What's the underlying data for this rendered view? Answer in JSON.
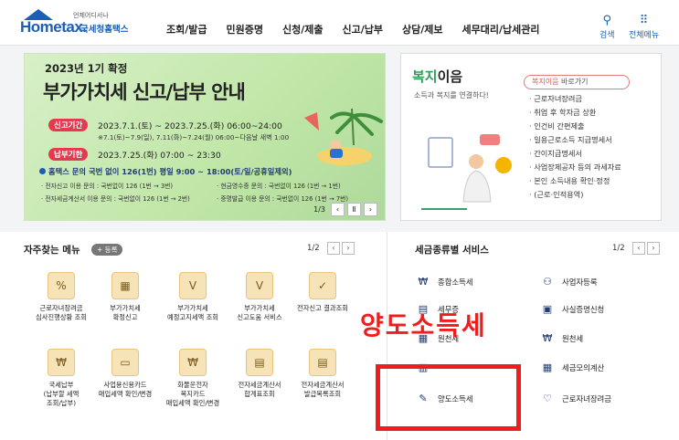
{
  "header": {
    "logo_text": "Hometax.",
    "logo_tagline": "언제어디서나",
    "logo_sub": "국세청홈택스",
    "nav": [
      "조회/발급",
      "민원증명",
      "신청/제출",
      "신고/납부",
      "상담/제보",
      "세무대리/납세관리"
    ],
    "tools": [
      {
        "icon": "search-icon",
        "glyph": "⚲",
        "label": "검색"
      },
      {
        "icon": "grid-menu-icon",
        "glyph": "⠿",
        "label": "전체메뉴"
      }
    ]
  },
  "banner": {
    "kicker": "2023년 1기 확정",
    "title": "부가가치세 신고/납부 안내",
    "period_label": "신고기간",
    "period_line": "2023.7.1.(토) ~ 2023.7.25.(화) 06:00~24:00",
    "period_note": "※7.1(토)~7.9(일), 7.11(화)~7.24(월) 06:00~다음날 새벽 1:00",
    "due_label": "납부기한",
    "due_line": "2023.7.25.(화) 07:00 ~ 23:30",
    "info": "홈택스 문의 국번 없이 126(1번) 평일 9:00 ~ 18:00(토/일/공휴일제외)",
    "small": [
      "· 전자신고 이용 문의 : 국번없이 126 (1번 → 3번)",
      "· 현금영수증 문의 : 국번없이 126 (1번 → 1번)",
      "· 전자세금계산서 이용 문의 : 국번없이 126 (1번 → 2번)",
      "· 증명발급 이용 문의 : 국번없이 126 (1번 → 7번)"
    ],
    "pager": "1/3",
    "colors": {
      "pill_period": "#e8384f",
      "pill_due": "#e8384f"
    }
  },
  "welfare": {
    "title_accent": "복지",
    "title_rest": "이음",
    "desc": "소득과 복지를 연결하다!",
    "link_accent": "복지이음",
    "link_rest": " 바로가기",
    "items": [
      "근로자녀장려금",
      "취업 후 학자금 상환",
      "인건비 간편제출",
      "일용근로소득 지급명세서",
      "간이지급명세서",
      "사업장제공자 등의 과세자료",
      "본인 소득내용 확인·정정",
      "(근로·인적용역)"
    ]
  },
  "favorites": {
    "title": "자주찾는 메뉴",
    "add_label": "+ 등록",
    "page": "1/2",
    "items": [
      {
        "icon": "percent-badge-icon",
        "glyph": "%",
        "label": "근로자녀장려금\n심사진행상황 조회"
      },
      {
        "icon": "calendar-icon",
        "glyph": "▦",
        "label": "부가가치세\n확정신고"
      },
      {
        "icon": "vat-doc-icon",
        "glyph": "V",
        "label": "부가가치세\n예정고지세액 조회"
      },
      {
        "icon": "vat-guide-icon",
        "glyph": "V",
        "label": "부가가치세\n신고도움 서비스"
      },
      {
        "icon": "check-doc-icon",
        "glyph": "✓",
        "label": "전자신고 결과조회"
      },
      {
        "icon": "payment-icon",
        "glyph": "₩",
        "label": "국세납부\n(납부할 세액\n조회/납부)"
      },
      {
        "icon": "card-icon",
        "glyph": "▭",
        "label": "사업용신용카드\n매입세액 확인/변경"
      },
      {
        "icon": "card-won-icon",
        "glyph": "₩",
        "label": "화물운전자\n복지카드\n매입세액 확인/변경"
      },
      {
        "icon": "invoice-icon",
        "glyph": "▤",
        "label": "전자세금계산서\n합계표조회"
      },
      {
        "icon": "invoice-list-icon",
        "glyph": "▤",
        "label": "전자세금계산서\n발급목록조회"
      }
    ]
  },
  "services": {
    "title": "세금종류별 서비스",
    "page": "1/2",
    "left": [
      {
        "icon": "income-tax-icon",
        "glyph": "₩",
        "label": "종합소득세"
      },
      {
        "icon": "doc-tax-icon",
        "glyph": "▤",
        "label": "세무증"
      },
      {
        "icon": "calc-icon",
        "glyph": "▦",
        "label": "원천세"
      },
      {
        "icon": "doc-icon",
        "glyph": "▥",
        "label": ""
      },
      {
        "icon": "transfer-tax-icon",
        "glyph": "✎",
        "label": "양도소득세"
      }
    ],
    "right": [
      {
        "icon": "person-icon",
        "glyph": "⚇",
        "label": "사업자등록"
      },
      {
        "icon": "cert-icon",
        "glyph": "▣",
        "label": "사실증명신청"
      },
      {
        "icon": "won-doc-icon",
        "glyph": "₩",
        "label": "원천세"
      },
      {
        "icon": "calculator-icon",
        "glyph": "▦",
        "label": "세금모의계산"
      },
      {
        "icon": "heart-icon",
        "glyph": "♡",
        "label": "근로자녀장려금"
      }
    ]
  },
  "overlay": {
    "callout": "양도소득세",
    "color": "#ef1d1d"
  }
}
